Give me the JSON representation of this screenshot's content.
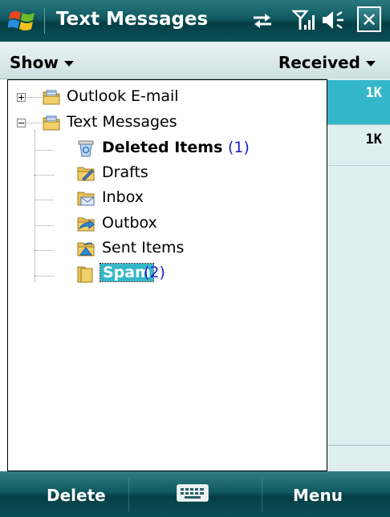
{
  "titlebar": {
    "title": "Text Messages"
  },
  "menu": {
    "show_label": "Show",
    "sort_label": "Received"
  },
  "folders": [
    {
      "name": "Outlook E-mail",
      "count": "",
      "level": 0,
      "expander": "plus",
      "icon": "account-folder-icon"
    },
    {
      "name": "Text Messages",
      "count": "",
      "level": 0,
      "expander": "minus",
      "icon": "account-folder-icon"
    },
    {
      "name": "Deleted Items",
      "count": "(1)",
      "level": 1,
      "bold": true,
      "icon": "recycle-bin-icon"
    },
    {
      "name": "Drafts",
      "count": "",
      "level": 1,
      "icon": "drafts-folder-icon"
    },
    {
      "name": "Inbox",
      "count": "",
      "level": 1,
      "icon": "inbox-folder-icon"
    },
    {
      "name": "Outbox",
      "count": "",
      "level": 1,
      "icon": "outbox-folder-icon"
    },
    {
      "name": "Sent Items",
      "count": "",
      "level": 1,
      "icon": "sent-folder-icon"
    },
    {
      "name": "Spam",
      "count": "(2)",
      "level": 1,
      "selected": true,
      "icon": "plain-folder-icon"
    }
  ],
  "message_sizes": [
    "1K",
    "1K"
  ],
  "softkeys": {
    "left": "Delete",
    "right": "Menu"
  },
  "colors": {
    "titlebar": "#0f5960",
    "selection": "#34b7c8",
    "count_text": "#1a1ad0",
    "strip_background": "#dfeef0"
  }
}
